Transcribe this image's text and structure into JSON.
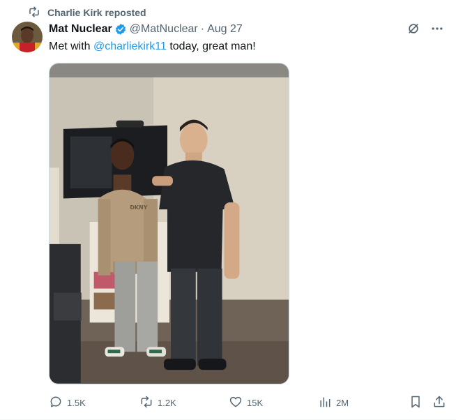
{
  "repost": {
    "label": "Charlie Kirk reposted"
  },
  "tweet": {
    "author_name": "Mat Nuclear",
    "handle": "@MatNuclear",
    "separator": "·",
    "date": "Aug 27",
    "text_before": "Met with ",
    "mention": "@charliekirk11",
    "text_after": " today, great man!"
  },
  "media": {
    "sweatshirt_text": "DKNY"
  },
  "actions": {
    "replies": "1.5K",
    "reposts": "1.2K",
    "likes": "15K",
    "views": "2M"
  },
  "colors": {
    "accent": "#1d9bf0",
    "muted": "#536471",
    "text": "#0f1419"
  },
  "icons": [
    "repost-icon",
    "verified-badge-icon",
    "grok-icon",
    "more-icon",
    "reply-icon",
    "like-icon",
    "views-icon",
    "bookmark-icon",
    "share-icon"
  ]
}
